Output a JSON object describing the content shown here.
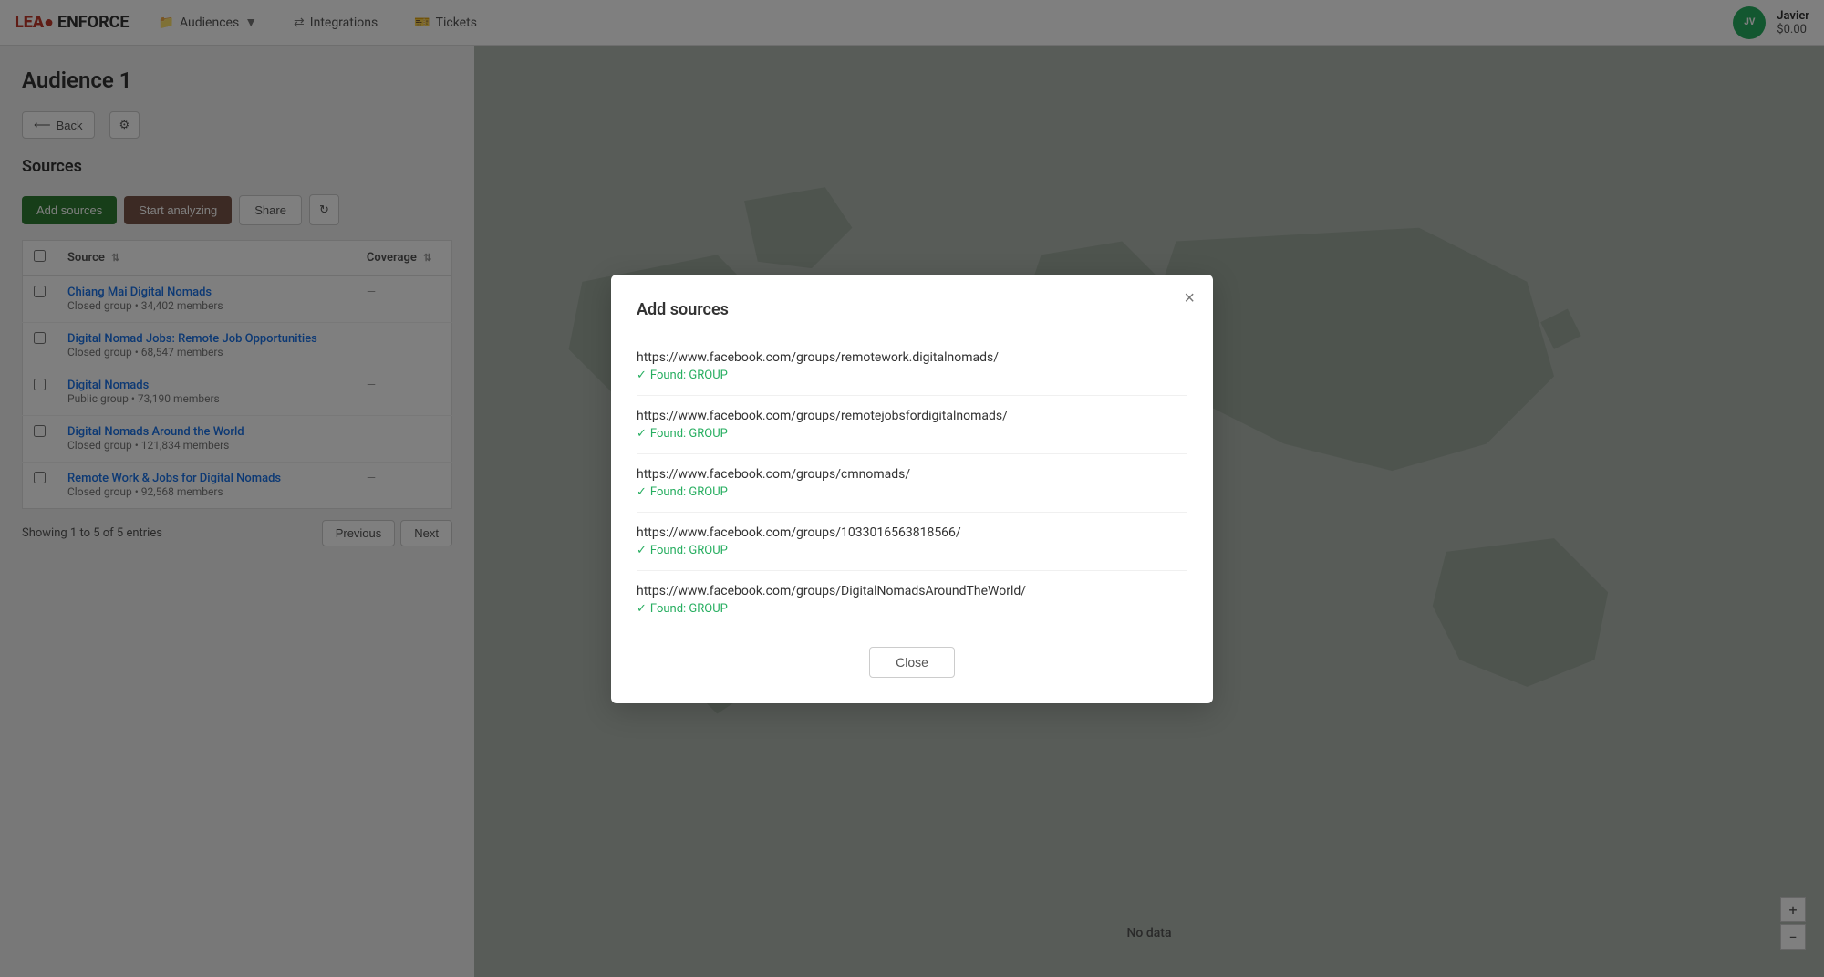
{
  "brand": {
    "lead": "LEA",
    "dot": "●",
    "enforce": "ENFORCE"
  },
  "navbar": {
    "items": [
      {
        "label": "Audiences",
        "icon": "▼",
        "prefix_icon": "📁"
      },
      {
        "label": "Integrations",
        "prefix_icon": "⇄"
      },
      {
        "label": "Tickets",
        "prefix_icon": "🎫"
      }
    ],
    "user": {
      "name": "Javier",
      "balance": "$0.00"
    }
  },
  "page": {
    "title": "Audience 1",
    "back_label": "Back",
    "sources_heading": "Sources"
  },
  "toolbar": {
    "add_sources_label": "Add sources",
    "start_analyzing_label": "Start analyzing",
    "share_label": "Share",
    "refresh_icon": "↻"
  },
  "table": {
    "columns": [
      "Source",
      "Coverage"
    ],
    "rows": [
      {
        "name": "Chiang Mai Digital Nomads",
        "meta": "Closed group • 34,402 members",
        "coverage": "—"
      },
      {
        "name": "Digital Nomad Jobs: Remote Job Opportunities",
        "meta": "Closed group • 68,547 members",
        "coverage": "—"
      },
      {
        "name": "Digital Nomads",
        "meta": "Public group • 73,190 members",
        "coverage": "—"
      },
      {
        "name": "Digital Nomads Around the World",
        "meta": "Closed group • 121,834 members",
        "coverage": "—"
      },
      {
        "name": "Remote Work & Jobs for Digital Nomads",
        "meta": "Closed group • 92,568 members",
        "coverage": "—"
      }
    ],
    "pagination": {
      "info": "Showing 1 to 5 of 5 entries",
      "prev_label": "Previous",
      "next_label": "Next"
    }
  },
  "map": {
    "no_data_label": "No data"
  },
  "modal": {
    "title": "Add sources",
    "close_label": "×",
    "sources": [
      {
        "url": "https://www.facebook.com/groups/remotework.digitalnomads/",
        "status": "Found: GROUP"
      },
      {
        "url": "https://www.facebook.com/groups/remotejobsfordigitalnomads/",
        "status": "Found: GROUP"
      },
      {
        "url": "https://www.facebook.com/groups/cmnomads/",
        "status": "Found: GROUP"
      },
      {
        "url": "https://www.facebook.com/groups/1033016563818566/",
        "status": "Found: GROUP"
      },
      {
        "url": "https://www.facebook.com/groups/DigitalNomadsAroundTheWorld/",
        "status": "Found: GROUP"
      }
    ],
    "close_button_label": "Close"
  }
}
